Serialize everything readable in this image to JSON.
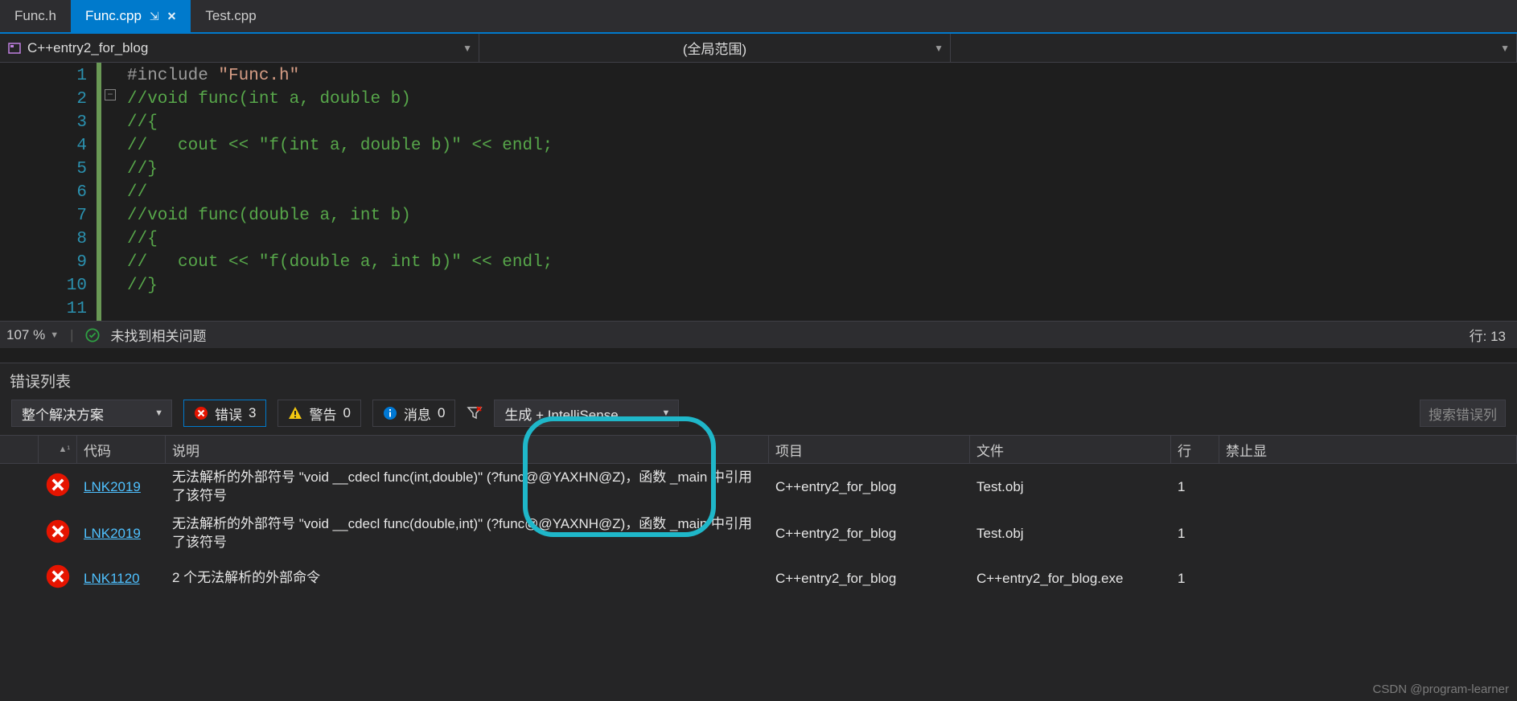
{
  "tabs": [
    {
      "label": "Func.h",
      "active": false,
      "pinned": false
    },
    {
      "label": "Func.cpp",
      "active": true,
      "pinned": true
    },
    {
      "label": "Test.cpp",
      "active": false,
      "pinned": false
    }
  ],
  "navbar": {
    "project": "C++entry2_for_blog",
    "scope": "(全局范围)",
    "member": ""
  },
  "code": {
    "lines": [
      {
        "n": 1,
        "segs": [
          {
            "c": "tk-pp",
            "t": "#include "
          },
          {
            "c": "tk-str",
            "t": "\"Func.h\""
          }
        ]
      },
      {
        "n": 2,
        "segs": [
          {
            "c": "tk-cmt",
            "t": "//void func(int a, double b)"
          }
        ]
      },
      {
        "n": 3,
        "segs": [
          {
            "c": "tk-cmt",
            "t": "//{"
          }
        ]
      },
      {
        "n": 4,
        "segs": [
          {
            "c": "tk-cmt",
            "t": "//   cout << \"f(int a, double b)\" << endl;"
          }
        ]
      },
      {
        "n": 5,
        "segs": [
          {
            "c": "tk-cmt",
            "t": "//}"
          }
        ]
      },
      {
        "n": 6,
        "segs": [
          {
            "c": "tk-cmt",
            "t": "//"
          }
        ]
      },
      {
        "n": 7,
        "segs": [
          {
            "c": "tk-cmt",
            "t": "//void func(double a, int b)"
          }
        ]
      },
      {
        "n": 8,
        "segs": [
          {
            "c": "tk-cmt",
            "t": "//{"
          }
        ]
      },
      {
        "n": 9,
        "segs": [
          {
            "c": "tk-cmt",
            "t": "//   cout << \"f(double a, int b)\" << endl;"
          }
        ]
      },
      {
        "n": 10,
        "segs": [
          {
            "c": "tk-cmt",
            "t": "//}"
          }
        ]
      },
      {
        "n": 11,
        "segs": [
          {
            "c": "",
            "t": ""
          }
        ]
      }
    ]
  },
  "editor_status": {
    "zoom": "107 %",
    "issues": "未找到相关问题",
    "position": "行: 13"
  },
  "error_panel": {
    "title": "错误列表",
    "scope_dropdown": "整个解决方案",
    "source_dropdown": "生成 + IntelliSense",
    "chips": {
      "errors": {
        "label": "错误",
        "count": "3"
      },
      "warnings": {
        "label": "警告",
        "count": "0"
      },
      "messages": {
        "label": "消息",
        "count": "0"
      }
    },
    "search_placeholder": "搜索错误列",
    "columns": {
      "code": "代码",
      "desc": "说明",
      "project": "项目",
      "file": "文件",
      "line": "行",
      "suppress": "禁止显"
    },
    "rows": [
      {
        "code": "LNK2019",
        "desc": "无法解析的外部符号 \"void __cdecl func(int,double)\" (?func@@YAXHN@Z)，函数 _main 中引用了该符号",
        "project": "C++entry2_for_blog",
        "file": "Test.obj",
        "line": "1"
      },
      {
        "code": "LNK2019",
        "desc": "无法解析的外部符号 \"void __cdecl func(double,int)\" (?func@@YAXNH@Z)，函数 _main 中引用了该符号",
        "project": "C++entry2_for_blog",
        "file": "Test.obj",
        "line": "1"
      },
      {
        "code": "LNK1120",
        "desc": "2 个无法解析的外部命令",
        "project": "C++entry2_for_blog",
        "file": "C++entry2_for_blog.exe",
        "line": "1"
      }
    ]
  },
  "watermark": "CSDN @program-learner"
}
